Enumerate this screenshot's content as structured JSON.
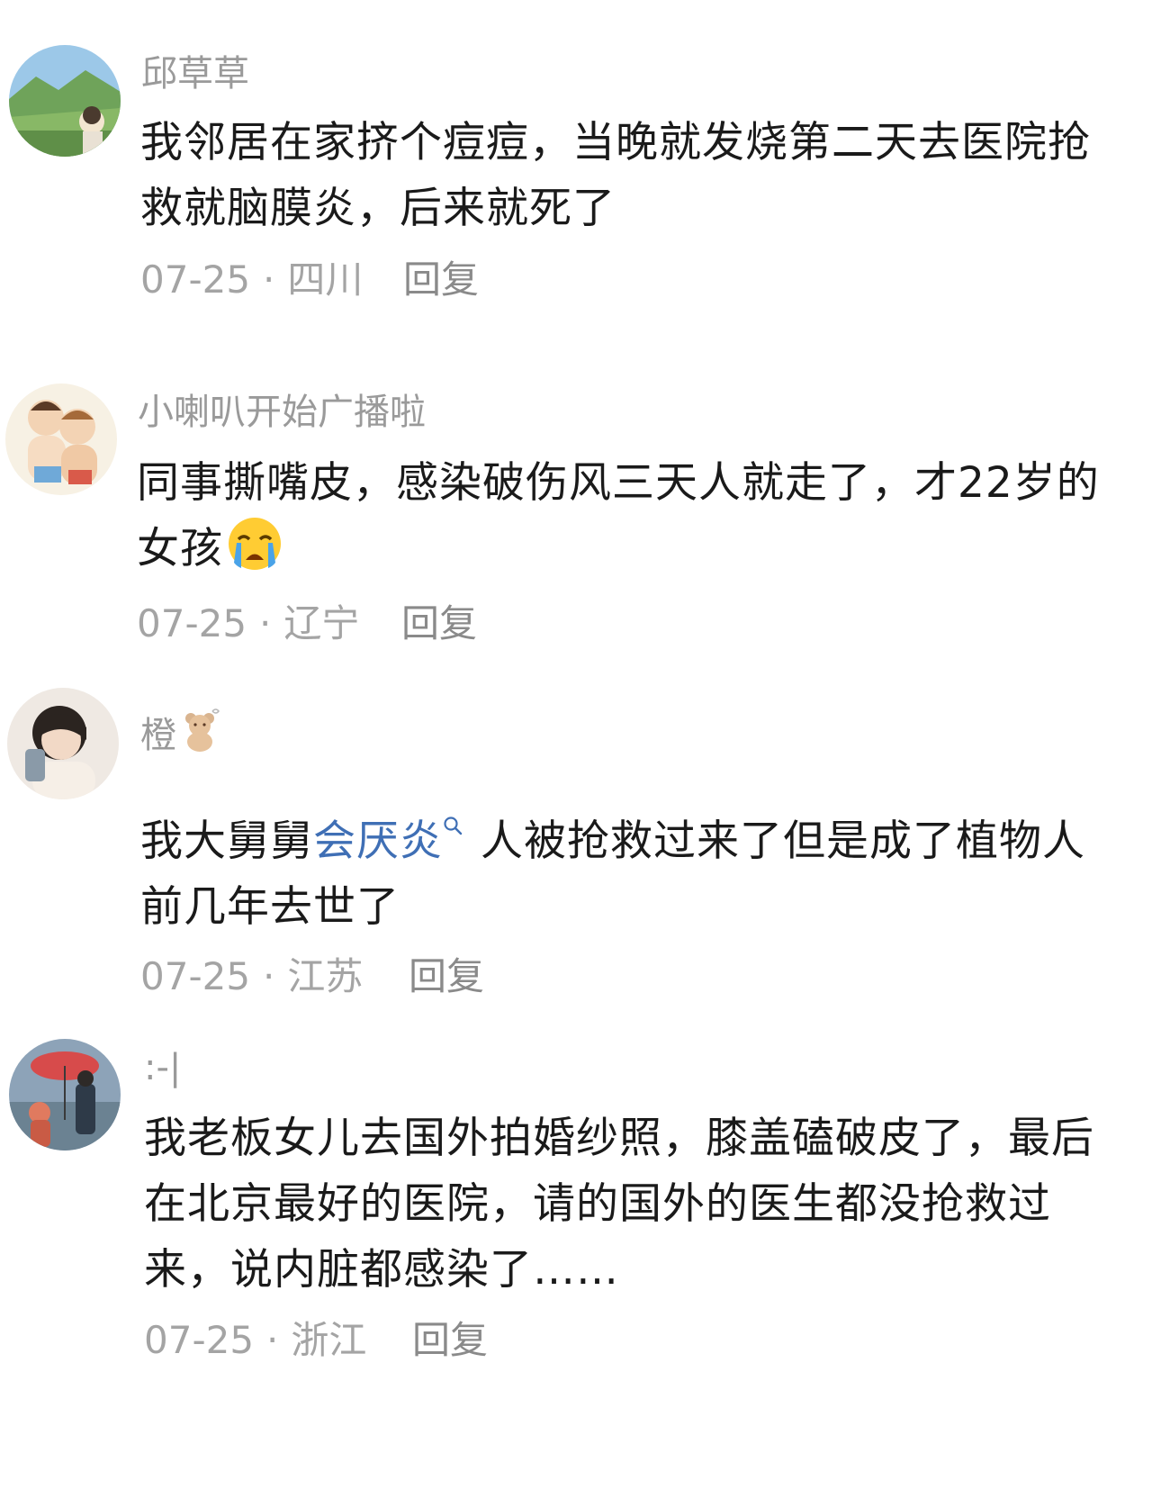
{
  "comments": [
    {
      "username": "邱草草",
      "text": "我邻居在家挤个痘痘，当晚就发烧第二天去医院抢救就脑膜炎，后来就死了",
      "date": "07-25",
      "location": "四川",
      "reply_label": "回复"
    },
    {
      "username": "小喇叭开始广播啦",
      "text": "同事撕嘴皮，感染破伤风三天人就走了，才22岁的女孩",
      "emoji": "crying-face",
      "date": "07-25",
      "location": "辽宁",
      "reply_label": "回复"
    },
    {
      "username": "橙",
      "username_emoji": "teddy-bear",
      "text_before": "我大舅舅",
      "link_text": "会厌炎",
      "text_after": "人被抢救过来了但是成了植物人 前几年去世了",
      "date": "07-25",
      "location": "江苏",
      "reply_label": "回复"
    },
    {
      "username": ":-|",
      "text": "我老板女儿去国外拍婚纱照，膝盖磕破皮了，最后在北京最好的医院，请的国外的医生都没抢救过来，说内脏都感染了……",
      "date": "07-25",
      "location": "浙江",
      "reply_label": "回复"
    }
  ],
  "meta_separator": "·",
  "colors": {
    "username": "#9a9a9a",
    "body": "#1a1a1a",
    "meta": "#a4a4a4",
    "link": "#3f6fb5"
  }
}
